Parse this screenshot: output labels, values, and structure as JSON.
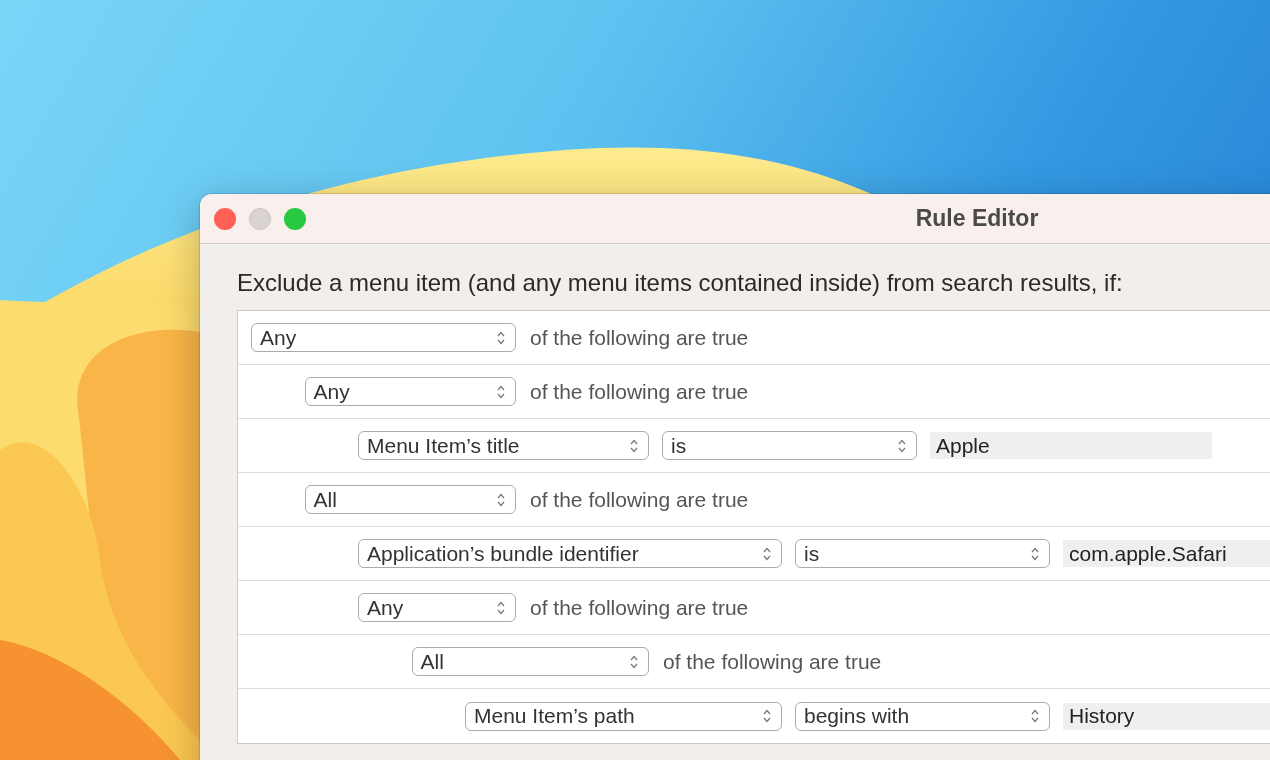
{
  "window": {
    "title": "Rule Editor",
    "buttons": [
      {
        "kind": "close",
        "disabled": false
      },
      {
        "kind": "minimize",
        "disabled": true
      },
      {
        "kind": "zoom",
        "disabled": false
      }
    ]
  },
  "description": "Exclude a menu item (and any menu items contained inside) from search results, if:",
  "rules": [
    {
      "kind": "group",
      "match": "Any",
      "suffix": "of the following are true",
      "children": [
        {
          "kind": "group",
          "match": "Any",
          "suffix": "of the following are true",
          "children": [
            {
              "kind": "condition",
              "attribute": "Menu Item’s title",
              "operator": "is",
              "value": "Apple"
            }
          ]
        },
        {
          "kind": "group",
          "match": "All",
          "suffix": "of the following are true",
          "children": [
            {
              "kind": "condition",
              "attribute": "Application’s bundle identifier",
              "operator": "is",
              "value": "com.apple.Safari"
            },
            {
              "kind": "group",
              "match": "Any",
              "suffix": "of the following are true",
              "children": [
                {
                  "kind": "group",
                  "match": "All",
                  "suffix": "of the following are true",
                  "children": [
                    {
                      "kind": "condition",
                      "attribute": "Menu Item’s path",
                      "operator": "begins with",
                      "value": "History"
                    }
                  ]
                }
              ]
            }
          ]
        }
      ]
    }
  ]
}
